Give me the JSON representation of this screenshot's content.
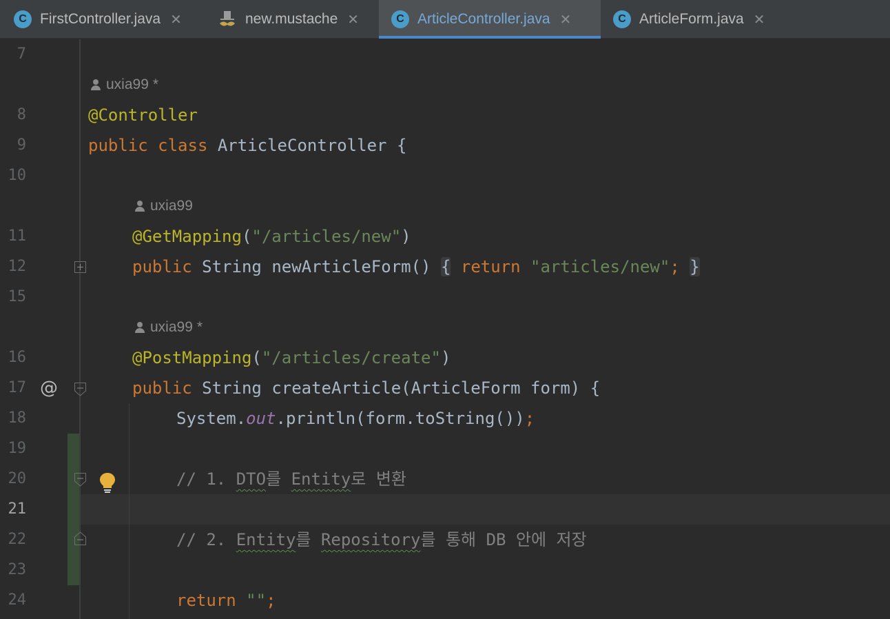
{
  "tabs": [
    {
      "label": "FirstController.java",
      "icon": "java-class-icon",
      "active": false
    },
    {
      "label": "new.mustache",
      "icon": "mustache-icon",
      "active": false
    },
    {
      "label": "ArticleController.java",
      "icon": "java-class-icon",
      "active": true
    },
    {
      "label": "ArticleForm.java",
      "icon": "java-class-icon",
      "active": false
    }
  ],
  "class_icon_letter": "C",
  "close_glyph": "✕",
  "gutter": {
    "line_numbers": [
      "7",
      "8",
      "9",
      "10",
      "11",
      "12",
      "15",
      "16",
      "17",
      "18",
      "19",
      "20",
      "21",
      "22",
      "23",
      "24"
    ],
    "current_line": "21",
    "at_symbol": "@"
  },
  "authors": {
    "a1": {
      "name": "uxia99",
      "suffix": "*"
    },
    "a2": {
      "name": "uxia99",
      "suffix": ""
    },
    "a3": {
      "name": "uxia99",
      "suffix": "*"
    }
  },
  "code": {
    "l8_ann": "@Controller",
    "l9_kw": "public class",
    "l9_name": "ArticleController",
    "l9_brace": "{",
    "l11_ann": "@GetMapping",
    "l11_open": "(",
    "l11_str": "\"/articles/new\"",
    "l11_close": ")",
    "l12_kw": "public",
    "l12_type": "String",
    "l12_name": "newArticleForm",
    "l12_parens": "()",
    "l12_open": "{",
    "l12_ret": "return",
    "l12_str": "\"articles/new\"",
    "l12_semi": ";",
    "l12_close": "}",
    "l16_ann": "@PostMapping",
    "l16_open": "(",
    "l16_str": "\"/articles/create\"",
    "l16_close": ")",
    "l17_kw": "public",
    "l17_type": "String",
    "l17_name": "createArticle",
    "l17_params": "(ArticleForm form) {",
    "l18_a": "System.",
    "l18_field": "out",
    "l18_b": ".println(form.toString())",
    "l18_semi": ";",
    "l20_prefix": "// 1. ",
    "l20_w1": "DTO",
    "l20_m1": "를 ",
    "l20_w2": "Entity",
    "l20_rest": "로 변환",
    "l22_prefix": "// 2. ",
    "l22_w1": "Entity",
    "l22_m1": "를 ",
    "l22_w2": "Repository",
    "l22_rest": "를 통해 DB 안에 저장",
    "l24_kw": "return",
    "l24_str": "\"\"",
    "l24_semi": ";"
  }
}
